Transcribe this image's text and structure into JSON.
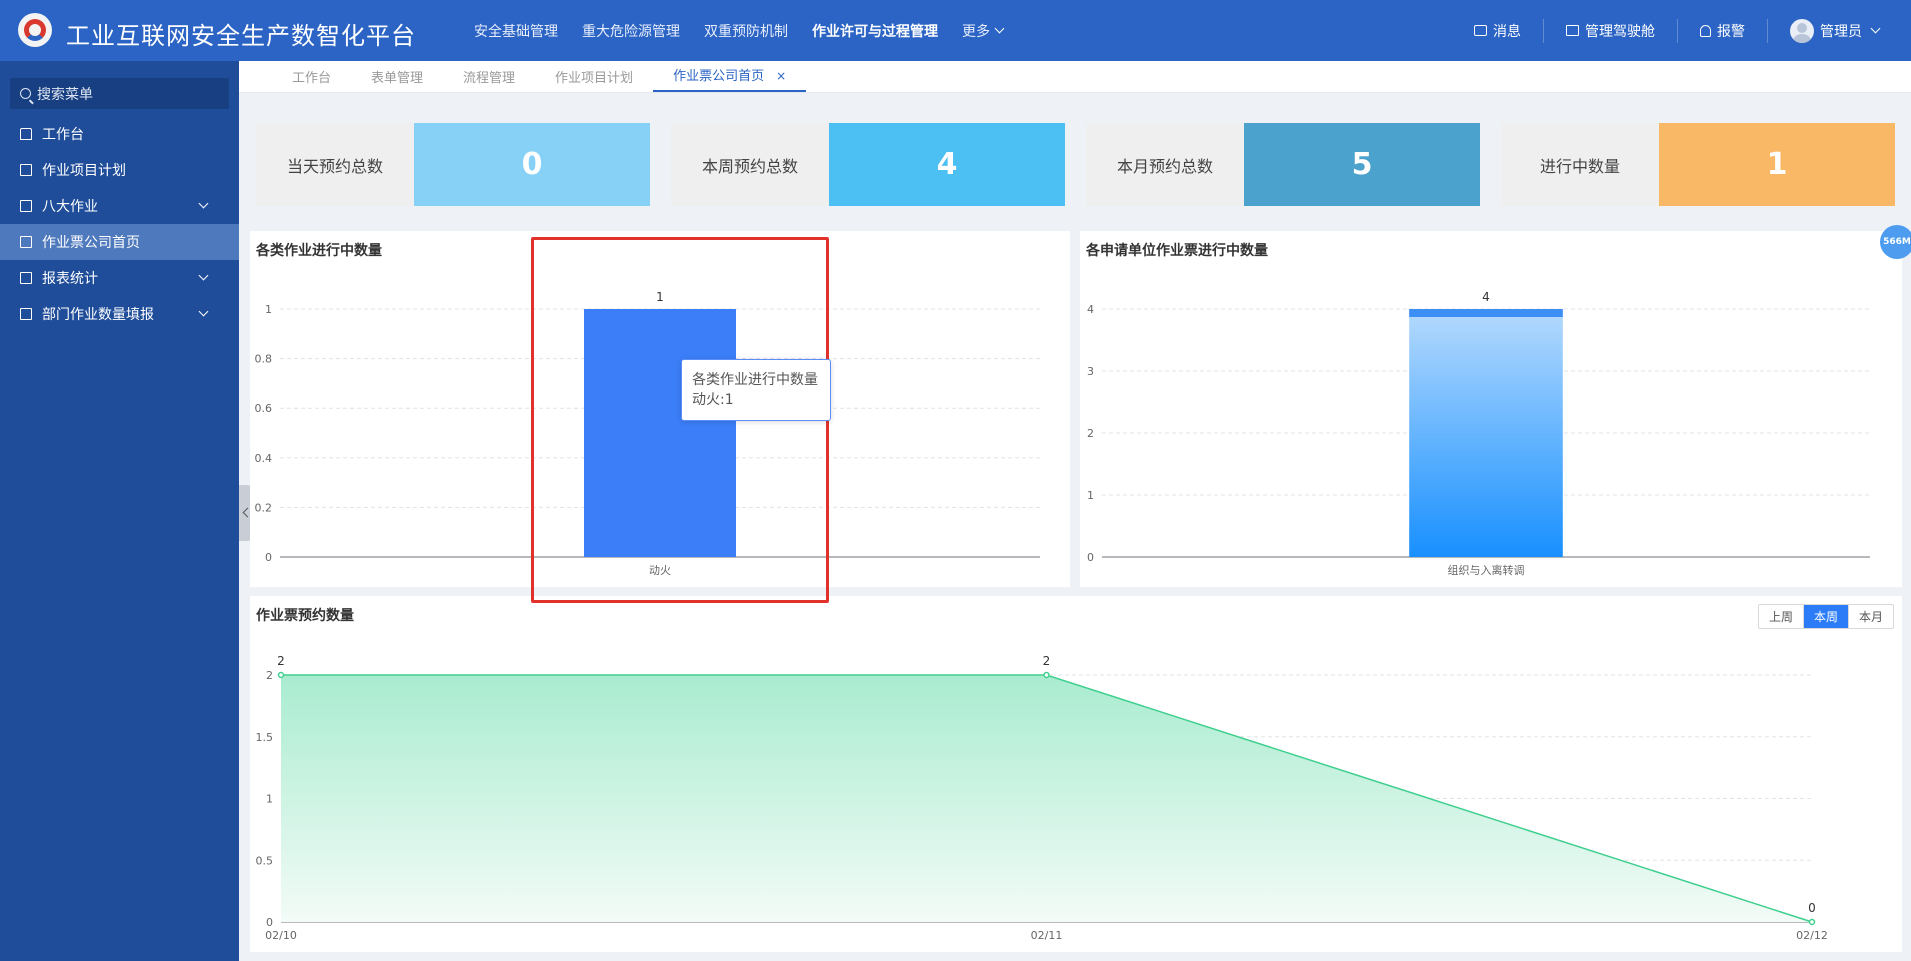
{
  "header": {
    "app_title": "工业互联网安全生产数智化平台",
    "nav": [
      {
        "label": "安全基础管理",
        "active": false
      },
      {
        "label": "重大危险源管理",
        "active": false
      },
      {
        "label": "双重预防机制",
        "active": false
      },
      {
        "label": "作业许可与过程管理",
        "active": true
      }
    ],
    "more_label": "更多",
    "messages_label": "消息",
    "cockpit_label": "管理驾驶舱",
    "alarm_label": "报警",
    "user_label": "管理员"
  },
  "sidebar": {
    "search_placeholder": "搜索菜单",
    "items": [
      {
        "label": "工作台",
        "icon": "home-icon",
        "expandable": false,
        "active": false
      },
      {
        "label": "作业项目计划",
        "icon": "list-icon",
        "expandable": false,
        "active": false
      },
      {
        "label": "八大作业",
        "icon": "task-icon",
        "expandable": true,
        "active": false
      },
      {
        "label": "作业票公司首页",
        "icon": "task-icon",
        "expandable": false,
        "active": true
      },
      {
        "label": "报表统计",
        "icon": "table-icon",
        "expandable": true,
        "active": false
      },
      {
        "label": "部门作业数量填报",
        "icon": "edit-icon",
        "expandable": true,
        "active": false
      }
    ]
  },
  "tabs": [
    {
      "label": "工作台",
      "active": false
    },
    {
      "label": "表单管理",
      "active": false
    },
    {
      "label": "流程管理",
      "active": false
    },
    {
      "label": "作业项目计划",
      "active": false
    },
    {
      "label": "作业票公司首页",
      "active": true,
      "close": "×"
    }
  ],
  "stats": [
    {
      "label": "当天预约总数",
      "value": "0",
      "color": "#87d1f7"
    },
    {
      "label": "本周预约总数",
      "value": "4",
      "color": "#4cbff3"
    },
    {
      "label": "本月预约总数",
      "value": "5",
      "color": "#4ba2cd"
    },
    {
      "label": "进行中数量",
      "value": "1",
      "color": "#f9b866"
    }
  ],
  "tooltip": {
    "title": "各类作业进行中数量",
    "body": "动火:1"
  },
  "range_buttons": [
    {
      "label": "上周",
      "active": false
    },
    {
      "label": "本周",
      "active": true
    },
    {
      "label": "本月",
      "active": false
    }
  ],
  "memory_badge": "566M",
  "chart_data": [
    {
      "type": "bar",
      "title": "各类作业进行中数量",
      "categories": [
        "动火"
      ],
      "values": [
        1
      ],
      "ylim": [
        0,
        1
      ],
      "yticks": [
        0,
        0.2,
        0.4,
        0.6,
        0.8,
        1
      ],
      "grid": true,
      "color": "#3c7ef8"
    },
    {
      "type": "bar",
      "title": "各申请单位作业票进行中数量",
      "categories": [
        "组织与入离转调"
      ],
      "values": [
        4
      ],
      "ylim": [
        0,
        4
      ],
      "yticks": [
        0,
        1,
        2,
        3,
        4
      ],
      "grid": true,
      "color": "#1890ff"
    },
    {
      "type": "area",
      "title": "作业票预约数量",
      "x": [
        "02/10",
        "02/11",
        "02/12"
      ],
      "values": [
        2,
        2,
        0
      ],
      "ylim": [
        0,
        2
      ],
      "yticks": [
        0,
        0.5,
        1,
        1.5,
        2
      ],
      "grid": true,
      "color": "#3fcf8e"
    }
  ]
}
